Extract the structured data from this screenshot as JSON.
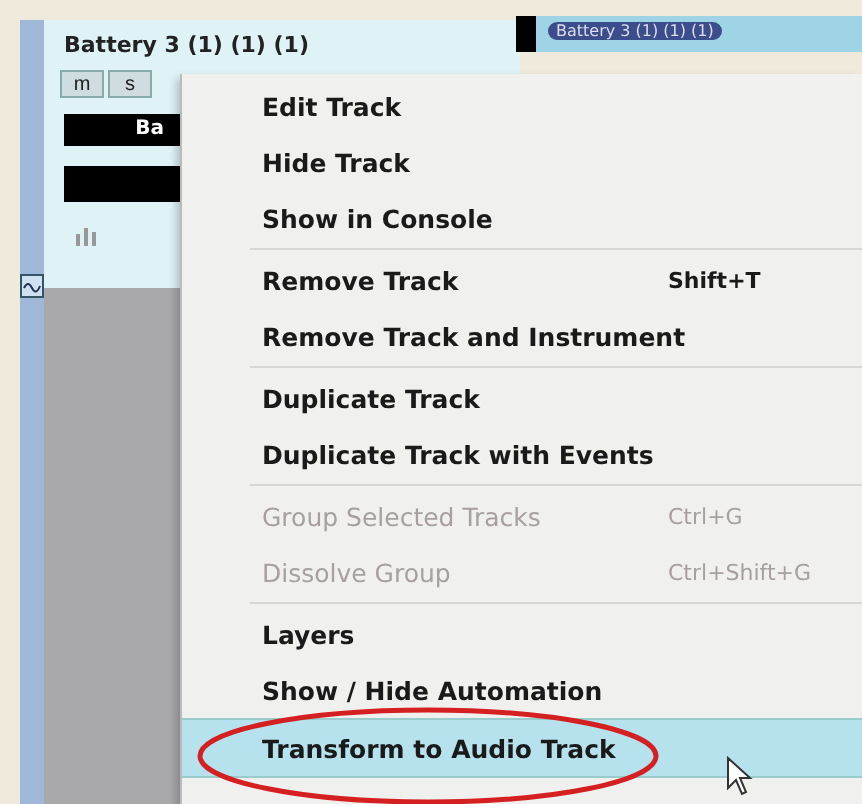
{
  "track": {
    "title": "Battery 3 (1) (1) (1)",
    "buttons": [
      "m",
      "s"
    ],
    "name_field": "Ba"
  },
  "clip": {
    "label": "Battery 3 (1) (1) (1)"
  },
  "menu": [
    {
      "kind": "item",
      "label": "Edit Track",
      "disabled": false,
      "selected": false,
      "circled": false
    },
    {
      "kind": "item",
      "label": "Hide Track",
      "disabled": false,
      "selected": false,
      "circled": false
    },
    {
      "kind": "item",
      "label": "Show in Console",
      "disabled": false,
      "selected": false,
      "circled": false
    },
    {
      "kind": "separator"
    },
    {
      "kind": "item",
      "label": "Remove Track",
      "shortcut": "Shift+T",
      "disabled": false,
      "selected": false,
      "circled": false
    },
    {
      "kind": "item",
      "label": "Remove Track and Instrument",
      "disabled": false,
      "selected": false,
      "circled": false
    },
    {
      "kind": "separator"
    },
    {
      "kind": "item",
      "label": "Duplicate Track",
      "disabled": false,
      "selected": false,
      "circled": false
    },
    {
      "kind": "item",
      "label": "Duplicate Track with Events",
      "disabled": false,
      "selected": false,
      "circled": false
    },
    {
      "kind": "separator"
    },
    {
      "kind": "item",
      "label": "Group Selected Tracks",
      "shortcut": "Ctrl+G",
      "disabled": true,
      "selected": false,
      "circled": false
    },
    {
      "kind": "item",
      "label": "Dissolve Group",
      "shortcut": "Ctrl+Shift+G",
      "disabled": true,
      "selected": false,
      "circled": false
    },
    {
      "kind": "separator"
    },
    {
      "kind": "item",
      "label": "Layers",
      "disabled": false,
      "selected": false,
      "circled": false
    },
    {
      "kind": "item",
      "label": "Show / Hide Automation",
      "disabled": false,
      "selected": false,
      "circled": false
    },
    {
      "kind": "item",
      "label": "Transform to Audio Track",
      "disabled": false,
      "selected": true,
      "circled": true
    }
  ]
}
